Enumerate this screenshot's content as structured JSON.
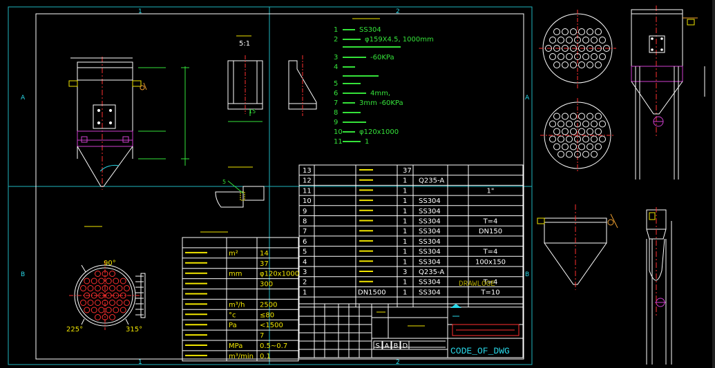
{
  "colors": {
    "background": "#000000",
    "frame": "#ffffff",
    "border": "#1fb6bf",
    "green": "#35e33a",
    "cyan": "#29d8e8",
    "yellow": "#f2e600",
    "red": "#ff3030",
    "magenta": "#d040d0",
    "orange": "#f0a030"
  },
  "frame": {
    "zone_top_1": "1",
    "zone_top_2": "2",
    "zone_bottom_1": "1",
    "zone_bottom_2": "2",
    "zone_left_a": "A",
    "zone_left_b": "B",
    "zone_right_a": "A",
    "zone_right_b": "B"
  },
  "detail": {
    "scale_label": "5:1",
    "bracket_dim": "15",
    "weld_label": "5"
  },
  "plan_view": {
    "angle_top": "90°",
    "angle_left": "225°",
    "angle_right": "315°"
  },
  "notes": [
    {
      "num": "1",
      "text": "SS304"
    },
    {
      "num": "2",
      "text": "φ159X4.5, 1000mm"
    },
    {
      "num": "3",
      "text": "-60KPa"
    },
    {
      "num": "4",
      "text": ""
    },
    {
      "num": "5",
      "text": ""
    },
    {
      "num": "6",
      "text": "4mm,"
    },
    {
      "num": "7",
      "text": "3mm -60KPa"
    },
    {
      "num": "8",
      "text": ""
    },
    {
      "num": "9",
      "text": ""
    },
    {
      "num": "10",
      "text": "φ120x1000"
    },
    {
      "num": "11",
      "text": "1"
    }
  ],
  "params": {
    "rows": [
      {
        "unit": "m²",
        "value": "14"
      },
      {
        "unit": "",
        "value": "37"
      },
      {
        "unit": "mm",
        "value": "φ120x1000"
      },
      {
        "unit": "",
        "value": "300"
      },
      {
        "unit": "",
        "value": ""
      },
      {
        "unit": "m³/h",
        "value": "2500"
      },
      {
        "unit": "°c",
        "value": "≤80"
      },
      {
        "unit": "Pa",
        "value": "<1500"
      },
      {
        "unit": "",
        "value": "7"
      },
      {
        "unit": "MPa",
        "value": "0.5~0.7"
      },
      {
        "unit": "m³/min",
        "value": "0.1"
      }
    ]
  },
  "bom": {
    "rows": [
      {
        "no": "13",
        "qty": "37",
        "mat": "",
        "note": ""
      },
      {
        "no": "12",
        "qty": "1",
        "mat": "Q235-A",
        "note": ""
      },
      {
        "no": "11",
        "qty": "1",
        "mat": "",
        "note": "1\""
      },
      {
        "no": "10",
        "qty": "1",
        "mat": "SS304",
        "note": ""
      },
      {
        "no": "9",
        "qty": "1",
        "mat": "SS304",
        "note": ""
      },
      {
        "no": "8",
        "qty": "1",
        "mat": "SS304",
        "note": "T=4"
      },
      {
        "no": "7",
        "qty": "1",
        "mat": "SS304",
        "note": "DN150"
      },
      {
        "no": "6",
        "qty": "1",
        "mat": "SS304",
        "note": ""
      },
      {
        "no": "5",
        "qty": "1",
        "mat": "SS304",
        "note": "T=4"
      },
      {
        "no": "4",
        "qty": "1",
        "mat": "SS304",
        "note": "100x150"
      },
      {
        "no": "3",
        "qty": "3",
        "mat": "Q235-A",
        "note": ""
      },
      {
        "no": "2",
        "qty": "1",
        "mat": "SS304",
        "note": "T=4"
      },
      {
        "no": "1",
        "qty": "1",
        "mat": "SS304",
        "note": "T=10",
        "name": "DN1500"
      }
    ],
    "overlay_text": "DRAWLOGE"
  },
  "title_block": {
    "scale_letters": [
      "S",
      "A",
      "B",
      "D"
    ],
    "code": "CODE_OF_DWG"
  }
}
